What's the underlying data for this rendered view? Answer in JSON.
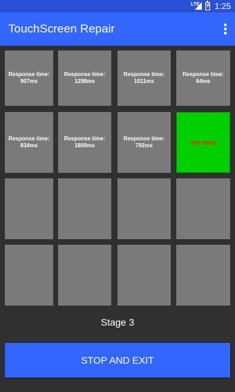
{
  "status_bar": {
    "network": "LTE",
    "time": "1:25"
  },
  "app_bar": {
    "title": "TouchScreen Repair"
  },
  "grid": [
    [
      "Response time: 907ms",
      "Response time: 1298ms",
      "Response time: 1011ms",
      "Response time: 64ms"
    ],
    [
      "Response time: 834ms",
      "Response time: 1869ms",
      "Response time: 792ms",
      "TAP HERE"
    ],
    [
      "",
      "",
      "",
      ""
    ],
    [
      "",
      "",
      "",
      ""
    ]
  ],
  "stage_label": "Stage 3",
  "stop_button_label": "STOP AND EXIT",
  "colors": {
    "primary": "#3366ff",
    "tile": "#7a7a7a",
    "tap_tile": "#00d000",
    "tap_text": "#ff1a1a",
    "background": "#303030"
  }
}
